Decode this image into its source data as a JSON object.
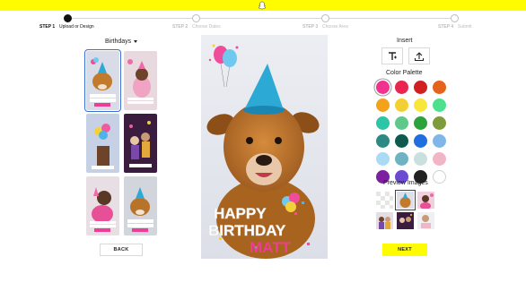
{
  "stepper": {
    "steps": [
      {
        "num": "STEP 1",
        "label": "Upload or Design"
      },
      {
        "num": "STEP 2",
        "label": "Choose Dates"
      },
      {
        "num": "STEP 3",
        "label": "Choose Area"
      },
      {
        "num": "STEP 4",
        "label": "Submit"
      }
    ],
    "active_step": 1
  },
  "gallery": {
    "category": "Birthdays",
    "back_label": "BACK",
    "selected_index": 0
  },
  "preview": {
    "line1": "HAPPY",
    "line2": "BIRTHDAY",
    "line3": "MATT"
  },
  "tools": {
    "insert_title": "Insert",
    "palette_title": "Color Palette",
    "palette": [
      "#f0338f",
      "#e8264f",
      "#d21f1f",
      "#e5631a",
      "#f5a21b",
      "#f3cf34",
      "#f8e73a",
      "#4de08e",
      "#2bc6a6",
      "#5ec98a",
      "#2ca23b",
      "#7f9c3c",
      "#2c8a84",
      "#0f5a4f",
      "#1f6fe0",
      "#7fb8e8",
      "#a9dbf5",
      "#6fb3c2",
      "#c9e0de",
      "#f1b6c6",
      "#7d1fa0",
      "#6b4bd1",
      "#222222",
      "#ffffff"
    ],
    "selected_color_index": 0,
    "preview_title": "Preview Images",
    "next_label": "NEXT"
  }
}
